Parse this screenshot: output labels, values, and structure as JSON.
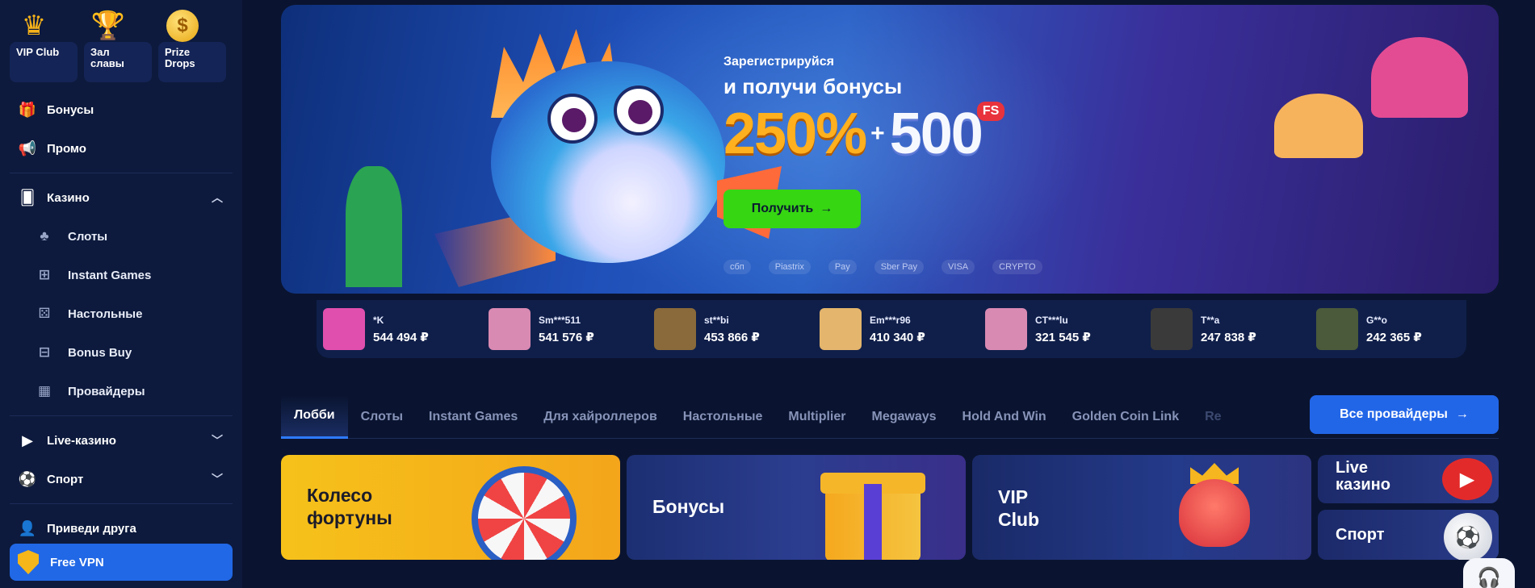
{
  "sidebar": {
    "top_cards": [
      {
        "label": "VIP Club",
        "icon": "crown-icon"
      },
      {
        "label": "Зал славы",
        "icon": "trophy-icon"
      },
      {
        "label": "Prize Drops",
        "icon": "coin-icon"
      }
    ],
    "items": [
      {
        "label": "Бонусы",
        "icon": "gift-icon"
      },
      {
        "label": "Промо",
        "icon": "megaphone-icon"
      },
      {
        "label": "Казино",
        "icon": "casino-icon"
      },
      {
        "label": "Слоты",
        "icon": "cherry-icon"
      },
      {
        "label": "Instant Games",
        "icon": "instant-icon"
      },
      {
        "label": "Настольные",
        "icon": "dice-icon"
      },
      {
        "label": "Bonus Buy",
        "icon": "gift-outline-icon"
      },
      {
        "label": "Провайдеры",
        "icon": "grid-icon"
      },
      {
        "label": "Live-казино",
        "icon": "live-icon"
      },
      {
        "label": "Спорт",
        "icon": "ball-icon"
      },
      {
        "label": "Приведи друга",
        "icon": "add-user-icon"
      }
    ],
    "vpn_label": "Free VPN"
  },
  "hero": {
    "small": "Зарегистрируйся",
    "big": "и получи бонусы",
    "percent": "250%",
    "plus": "+",
    "spins": "500",
    "fs": "FS",
    "button": "Получить",
    "payments": [
      "сбп",
      "Piastrix",
      "Pay",
      "Sber Pay",
      "VISA",
      "CRYPTO"
    ]
  },
  "winners": [
    {
      "name": "*K",
      "amount": "544 494 ₽",
      "color": "#e04fae"
    },
    {
      "name": "Sm***511",
      "amount": "541 576 ₽",
      "color": "#d98ab3"
    },
    {
      "name": "st**bi",
      "amount": "453 866 ₽",
      "color": "#8a6a3a"
    },
    {
      "name": "Em***r96",
      "amount": "410 340 ₽",
      "color": "#e4b56c"
    },
    {
      "name": "CT***lu",
      "amount": "321 545 ₽",
      "color": "#d98ab3"
    },
    {
      "name": "T**a",
      "amount": "247 838 ₽",
      "color": "#3a3a3a"
    },
    {
      "name": "G**o",
      "amount": "242 365 ₽",
      "color": "#4a5a3a"
    }
  ],
  "tabs": [
    "Лобби",
    "Слоты",
    "Instant Games",
    "Для хайроллеров",
    "Настольные",
    "Multiplier",
    "Megaways",
    "Hold And Win",
    "Golden Coin Link",
    "Re"
  ],
  "providers_button": "Все провайдеры",
  "promos": {
    "wheel": "Колесо фортуны",
    "bonus": "Бонусы",
    "vip": "VIP Club",
    "live": "Live казино",
    "sport": "Спорт"
  }
}
